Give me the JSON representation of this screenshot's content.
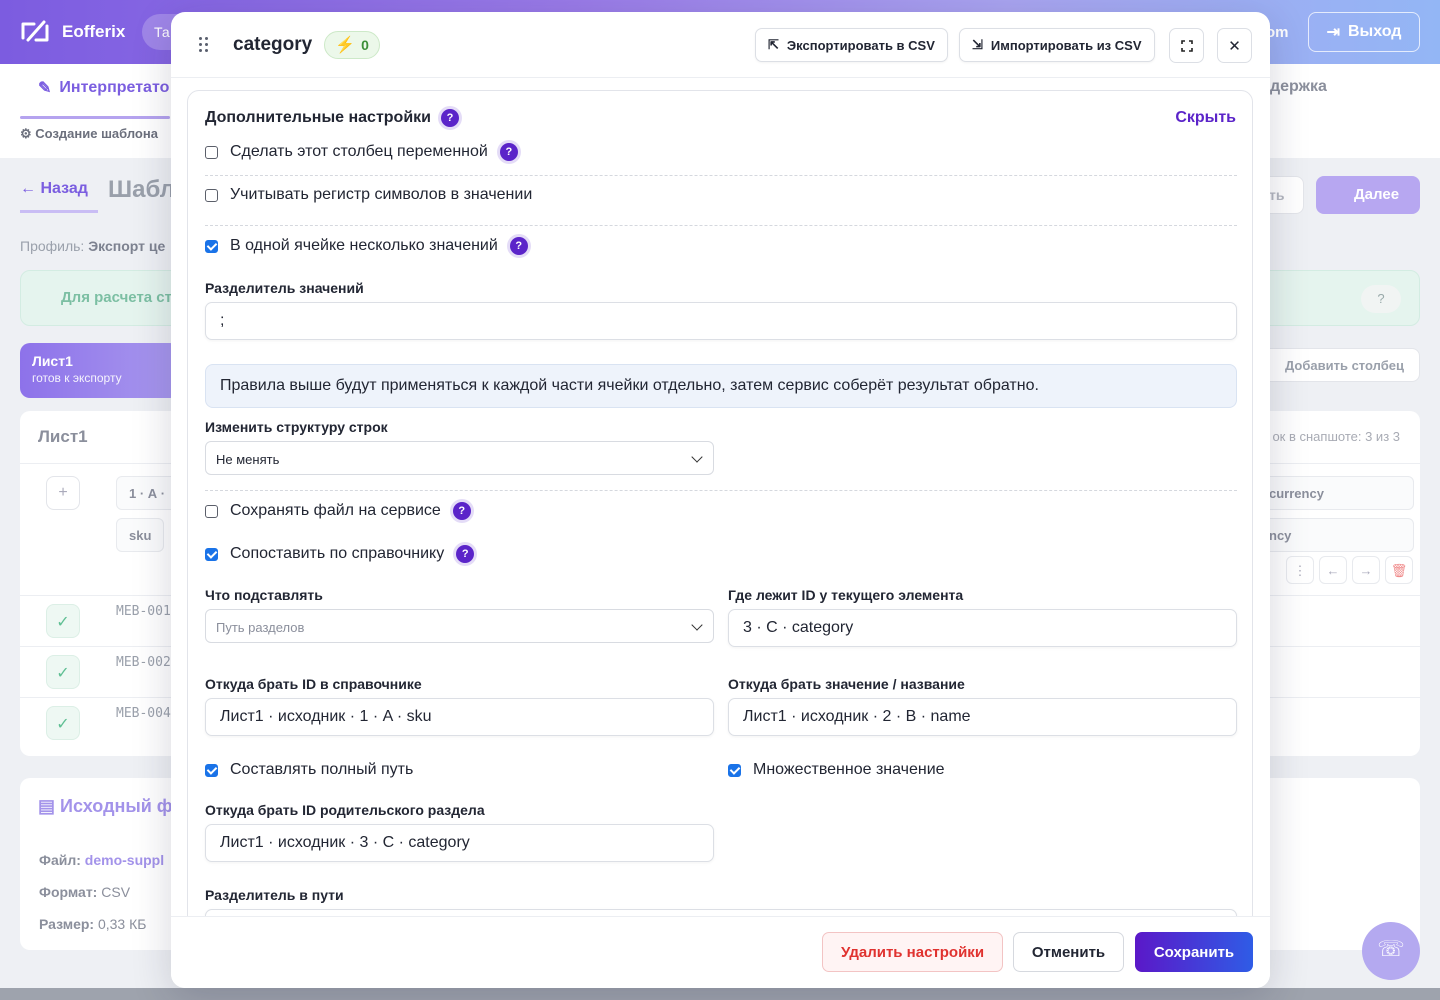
{
  "app": {
    "brand": "Eofferix",
    "header_pill": "Та",
    "header_right_text": "om",
    "logout_label": "Выход"
  },
  "subnav": {
    "active_tab": "Интерпретато",
    "support_tab": "держка",
    "breadcrumb": "Создание шаблона"
  },
  "background": {
    "back_label": "Назад",
    "page_title": "Шабл",
    "profile_label": "Профиль:",
    "profile_value": "Экспорт це",
    "banner_text": "Для расчета ст",
    "next_label": "Далее",
    "ghost_label": "ть",
    "add_column_label": "Добавить столбец",
    "sheet_chip": {
      "name": "Лист1",
      "status": "готов к экспорту"
    },
    "table": {
      "title": "Лист1",
      "snapshot": "ок в снапшоте: 3 из 3",
      "column_chip_1": "1 · А ·",
      "column_chip_2": "sku",
      "column_chip_3": "currency",
      "column_chip_4": "ncy",
      "rows": [
        "MEB-001",
        "MEB-002",
        "MEB-004"
      ]
    },
    "source": {
      "title": "Исходный ф",
      "file_label": "Файл:",
      "file_value": "demo-suppl",
      "format_label": "Формат:",
      "format_value": "CSV",
      "size_label": "Размер:",
      "size_value": "0,33 КБ"
    }
  },
  "modal": {
    "title": "category",
    "badge_count": "0",
    "export_csv_label": "Экспортировать в CSV",
    "import_csv_label": "Импортировать из CSV",
    "panel": {
      "title": "Дополнительные настройки",
      "hide_label": "Скрыть",
      "help_glyph": "?",
      "check_variable": {
        "label": "Сделать этот столбец переменной",
        "checked": false
      },
      "check_case": {
        "label": "Учитывать регистр символов в значении",
        "checked": false
      },
      "check_multi": {
        "label": "В одной ячейке несколько значений",
        "checked": true
      },
      "separator_label": "Разделитель значений",
      "separator_value": ";",
      "info_text": "Правила выше будут применяться к каждой части ячейки отдельно, затем сервис соберёт результат обратно.",
      "structure_label": "Изменить структуру строк",
      "structure_value": "Не менять",
      "check_save_file": {
        "label": "Сохранять файл на сервисе",
        "checked": false
      },
      "check_dictionary": {
        "label": "Сопоставить по справочнику",
        "checked": true
      },
      "what_label": "Что подставлять",
      "what_placeholder": "Путь разделов",
      "where_id_label": "Где лежит ID у текущего элемента",
      "where_id_value": "3 · C · category",
      "dict_id_label": "Откуда брать ID в справочнике",
      "dict_id_value": "Лист1 · исходник · 1 · A · sku",
      "dict_value_label": "Откуда брать значение / название",
      "dict_value_value": "Лист1 · исходник · 2 · B · name",
      "check_full_path": {
        "label": "Составлять полный путь",
        "checked": true
      },
      "check_multiple": {
        "label": "Множественное значение",
        "checked": true
      },
      "parent_id_label": "Откуда брать ID родительского раздела",
      "parent_id_value": "Лист1 · исходник · 3 · C · category",
      "path_sep_label": "Разделитель в пути"
    },
    "footer": {
      "delete_label": "Удалить настройки",
      "cancel_label": "Отменить",
      "save_label": "Сохранить"
    }
  },
  "colors": {
    "accent": "#5b24c9",
    "save_gradient_start": "#5b18c8",
    "save_gradient_end": "#2f5ce6",
    "danger": "#e0322f",
    "checkbox": "#1a73e8"
  }
}
